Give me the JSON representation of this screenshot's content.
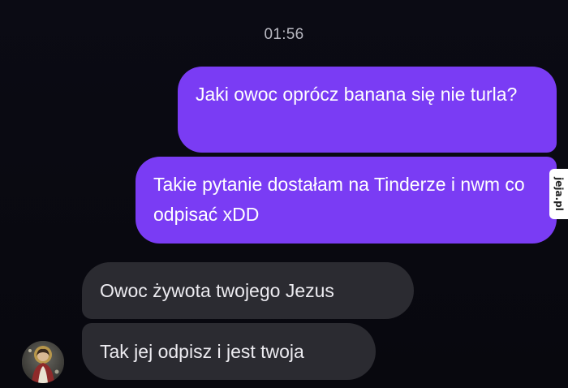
{
  "chat": {
    "timestamp": "01:56",
    "messages": [
      {
        "direction": "outgoing",
        "text": "Jaki owoc oprócz banana się nie turla?"
      },
      {
        "direction": "outgoing",
        "text": "Takie pytanie dostałam na Tinderze i nwm co odpisać xDD"
      },
      {
        "direction": "incoming",
        "text": "Owoc żywota twojego Jezus"
      },
      {
        "direction": "incoming",
        "text": "Tak jej odpisz i jest twoja"
      }
    ]
  },
  "contact": {
    "avatar_icon": "contact-avatar-icon"
  },
  "watermark": {
    "text": "jeja.pl"
  },
  "colors": {
    "background": "#08080e",
    "outgoing_bubble": "#7a3cf4",
    "incoming_bubble": "#2b2b31",
    "timestamp_text": "#b9b9c2"
  }
}
